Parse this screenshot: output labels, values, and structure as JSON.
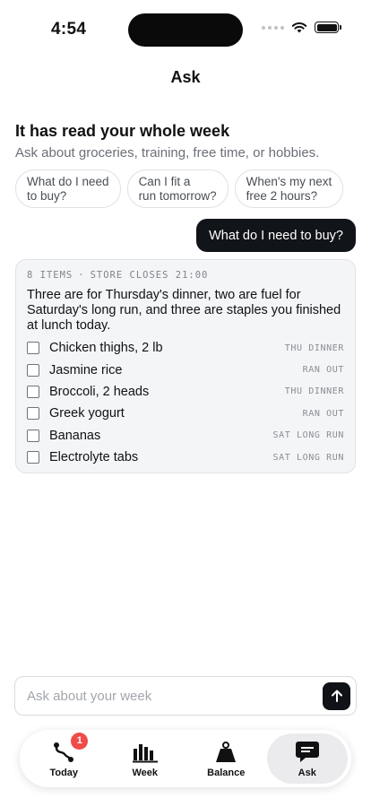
{
  "status_bar": {
    "time": "4:54"
  },
  "nav": {
    "title": "Ask"
  },
  "intro": {
    "title": "It has read your whole week",
    "subtitle": "Ask about groceries, training, free time, or hobbies."
  },
  "suggestions": [
    {
      "line1": "What do I need",
      "line2": "to buy?"
    },
    {
      "line1": "Can I fit a",
      "line2": "run tomorrow?"
    },
    {
      "line1": "When's my next",
      "line2": "free 2 hours?"
    }
  ],
  "user_message": "What do I need to buy?",
  "answer": {
    "meta_count": "8 ITEMS",
    "meta_separator": "·",
    "meta_store": "STORE CLOSES 21:00",
    "body": "Three are for Thursday's dinner, two are fuel for Saturday's long run, and three are staples you finished at lunch today.",
    "items": [
      {
        "label": "Chicken thighs, 2 lb",
        "tag": "THU DINNER"
      },
      {
        "label": "Jasmine rice",
        "tag": "RAN OUT"
      },
      {
        "label": "Broccoli, 2 heads",
        "tag": "THU DINNER"
      },
      {
        "label": "Greek yogurt",
        "tag": "RAN OUT"
      },
      {
        "label": "Bananas",
        "tag": "SAT LONG RUN"
      },
      {
        "label": "Electrolyte tabs",
        "tag": "SAT LONG RUN"
      }
    ]
  },
  "composer": {
    "placeholder": "Ask about your week"
  },
  "tabs": [
    {
      "label": "Today",
      "icon": "route-icon",
      "badge": "1"
    },
    {
      "label": "Week",
      "icon": "bar-chart-icon"
    },
    {
      "label": "Balance",
      "icon": "weight-icon"
    },
    {
      "label": "Ask",
      "icon": "chat-bubble-icon",
      "active": true
    }
  ],
  "colors": {
    "badge": "#f04b4b",
    "accent_dark": "#111418",
    "active_tab": "#ebebed"
  }
}
